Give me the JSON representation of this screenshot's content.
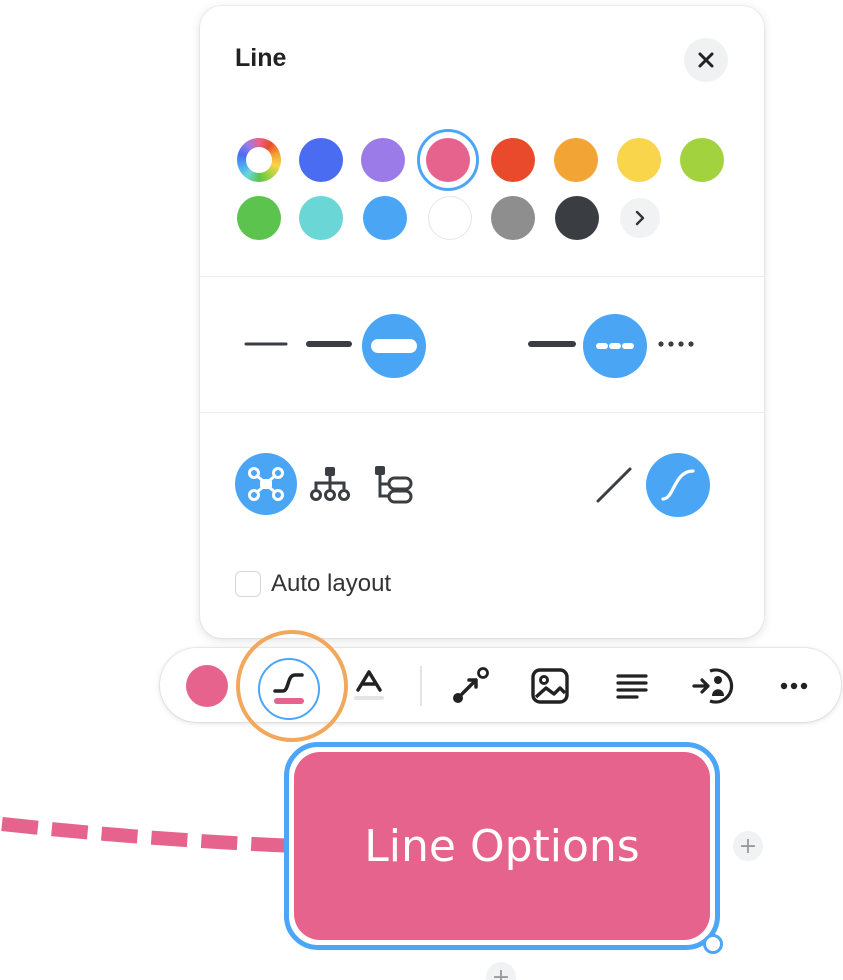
{
  "panel": {
    "title": "Line",
    "colors": [
      "rainbow",
      "#4a6cf0",
      "#9b7be8",
      "#e5638c",
      "#ea4a2c",
      "#f2a434",
      "#f8d54a",
      "#a2d33e",
      "#5cc34f",
      "#6ad7d6",
      "#4aa6f4",
      "#ffffff",
      "#8e8e8e",
      "#3a3d42"
    ],
    "selected_color": "#e5638c",
    "line_widths": [
      "thin",
      "medium",
      "thick"
    ],
    "selected_width": "thick",
    "line_styles": [
      "solid",
      "dashed",
      "dotted"
    ],
    "selected_style": "dashed",
    "layouts": [
      "mindmap-icon",
      "org-chart-icon",
      "tree-icon"
    ],
    "selected_layout": "mindmap-icon",
    "line_shapes": [
      "straight-line-icon",
      "curved-line-icon"
    ],
    "selected_shape": "curved-line-icon",
    "auto_layout_label": "Auto layout",
    "auto_layout_checked": false
  },
  "toolbar": {
    "items": [
      "color-swatch",
      "line-style-icon",
      "text-style-icon",
      "connection-icon",
      "image-icon",
      "align-icon",
      "focus-icon",
      "more-icon"
    ],
    "active_color": "#e5638c",
    "active_item": "line-style-icon"
  },
  "node": {
    "label": "Line Options",
    "fill": "#e5638c",
    "border": "#4da5f5",
    "add_child_symbol": "+"
  },
  "connector": {
    "color": "#e5638c",
    "style": "dashed"
  }
}
